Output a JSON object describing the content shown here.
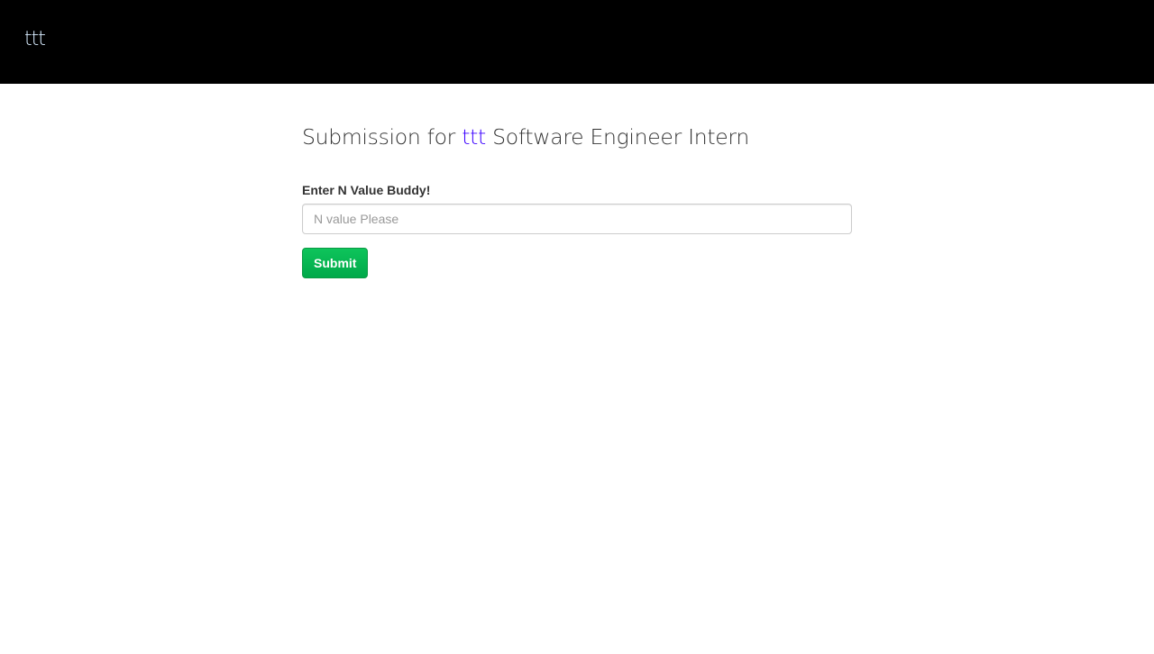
{
  "navbar": {
    "brand": "ttt"
  },
  "main": {
    "title_prefix": "Submission for ",
    "company": "ttt",
    "title_suffix": " Software Engineer Intern",
    "field_label": "Enter N Value Buddy!",
    "field_value": "",
    "field_placeholder": "N value Please",
    "submit_label": "Submit"
  },
  "colors": {
    "navbar_bg": "#000000",
    "company_accent": "#3b00ff",
    "submit_bg": "#00b04f"
  }
}
